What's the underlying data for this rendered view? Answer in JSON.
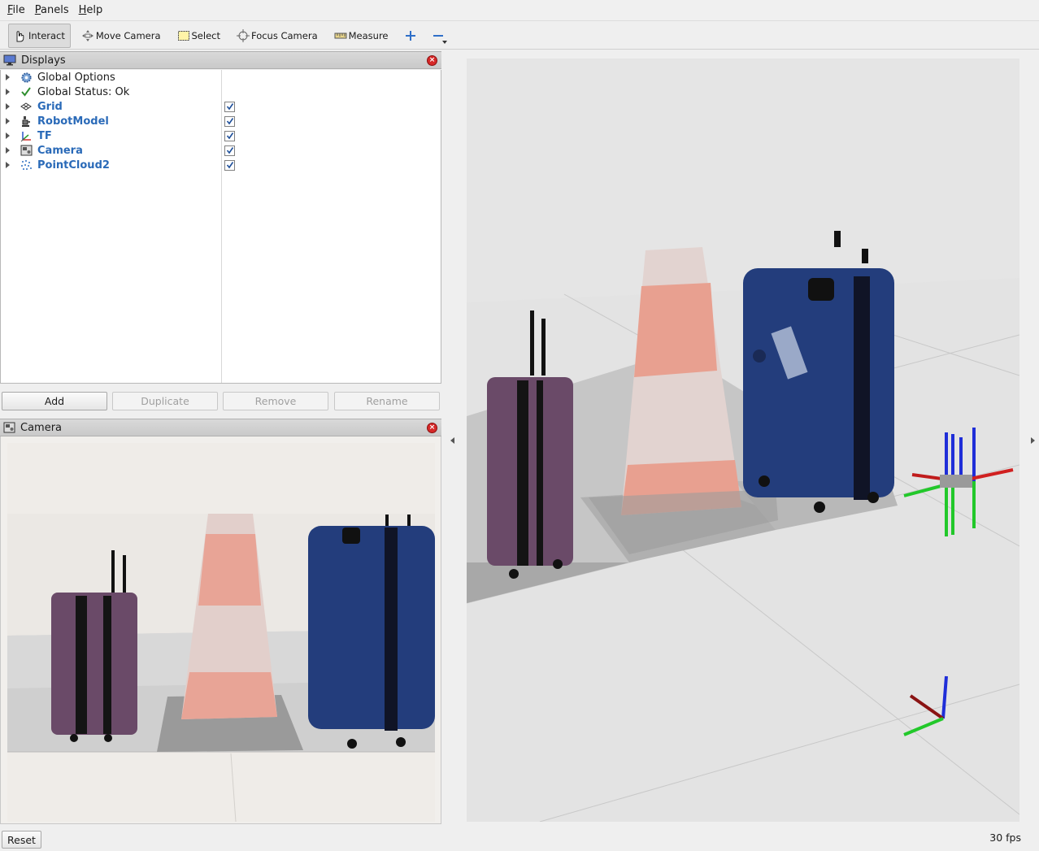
{
  "menubar": {
    "items": [
      {
        "label": "File",
        "mnemonic": "F",
        "rest": "ile"
      },
      {
        "label": "Panels",
        "mnemonic": "P",
        "rest": "anels"
      },
      {
        "label": "Help",
        "mnemonic": "H",
        "rest": "elp"
      }
    ]
  },
  "toolbar": {
    "interact": "Interact",
    "move_camera": "Move Camera",
    "select": "Select",
    "focus_camera": "Focus Camera",
    "measure": "Measure"
  },
  "displays_panel": {
    "title": "Displays",
    "items": [
      {
        "label": "Global Options",
        "icon": "gear-icon",
        "is_display": false
      },
      {
        "label": "Global Status: Ok",
        "icon": "checkmark-icon",
        "is_display": false
      },
      {
        "label": "Grid",
        "icon": "grid-icon",
        "is_display": true,
        "checked": true
      },
      {
        "label": "RobotModel",
        "icon": "robot-icon",
        "is_display": true,
        "checked": true
      },
      {
        "label": "TF",
        "icon": "axes-icon",
        "is_display": true,
        "checked": true
      },
      {
        "label": "Camera",
        "icon": "camera-icon",
        "is_display": true,
        "checked": true
      },
      {
        "label": "PointCloud2",
        "icon": "pointcloud-icon",
        "is_display": true,
        "checked": true
      }
    ],
    "buttons": {
      "add": "Add",
      "duplicate": "Duplicate",
      "remove": "Remove",
      "rename": "Rename"
    }
  },
  "camera_panel": {
    "title": "Camera"
  },
  "status": {
    "reset": "Reset",
    "fps": "30 fps"
  },
  "colors": {
    "display_label": "#2a6ab8",
    "close_button": "#d62828",
    "view_background": "#e4e4e4"
  }
}
